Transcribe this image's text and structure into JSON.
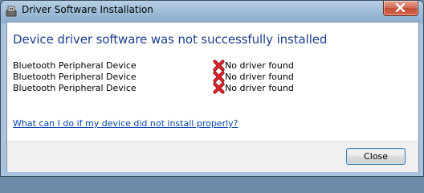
{
  "window": {
    "title": "Driver Software Installation"
  },
  "heading": "Device driver software was not successfully installed",
  "devices": [
    {
      "name": "Bluetooth Peripheral Device",
      "status": "No driver found",
      "status_icon": "error-x-icon"
    },
    {
      "name": "Bluetooth Peripheral Device",
      "status": "No driver found",
      "status_icon": "error-x-icon"
    },
    {
      "name": "Bluetooth Peripheral Device",
      "status": "No driver found",
      "status_icon": "error-x-icon"
    }
  ],
  "help_link": "What can I do if my device did not install properly?",
  "buttons": {
    "close_label": "Close"
  },
  "colors": {
    "heading": "#1b3f8f",
    "link": "#0645ad",
    "error_red": "#d4161d",
    "titlebar_close": "#c44b34"
  }
}
